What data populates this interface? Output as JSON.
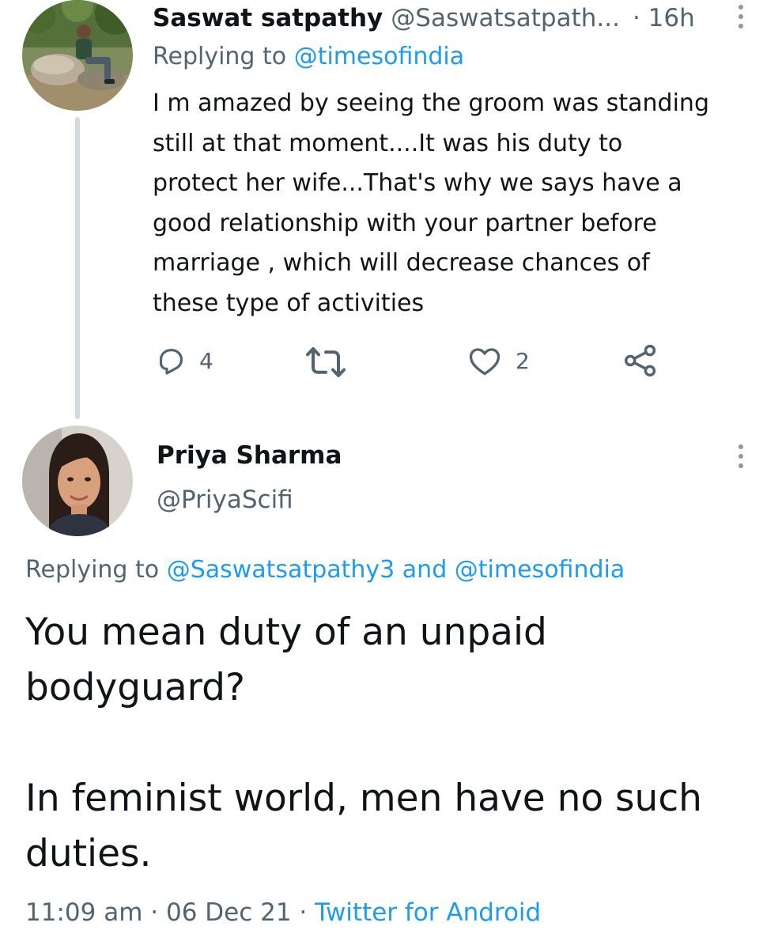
{
  "tweets": [
    {
      "author_name": "Saswat satpathy",
      "author_handle": "@Saswatsatpath...",
      "time_sep": "·",
      "time": "16h",
      "replying_prefix": "Replying to",
      "replying_to": "@timesofindia",
      "body": "I m amazed by seeing the groom was standing\nstill at that moment....It was his duty to\nprotect her wife...That's why we says have a\ngood relationship with your partner before\nmarriage , which will decrease chances of\nthese type of activities",
      "reply_count": "4",
      "retweet_count": "",
      "like_count": "2",
      "avatar_icon": "user-avatar-outdoor-photo"
    },
    {
      "author_name": "Priya Sharma",
      "author_handle": "@PriyaScifi",
      "replying_prefix": "Replying to",
      "replying_to_1": "@Saswatsatpathy3",
      "replying_and": "and",
      "replying_to_2": "@timesofindia",
      "body_paragraphs": [
        "You mean duty of an unpaid bodyguard?",
        "In feminist world, men have no such duties."
      ],
      "time": "11:09 am",
      "sep1": "·",
      "date": "06 Dec 21",
      "sep2": "·",
      "source": "Twitter for Android",
      "avatar_icon": "user-avatar-portrait-photo"
    }
  ],
  "icons": {
    "reply": "reply-icon",
    "retweet": "retweet-icon",
    "like": "heart-icon",
    "share": "share-icon",
    "more": "more-options-icon"
  },
  "colors": {
    "text_primary": "#0f1419",
    "text_secondary": "#536471",
    "link": "#1d9bf0",
    "thread_line": "#cfd9de"
  }
}
